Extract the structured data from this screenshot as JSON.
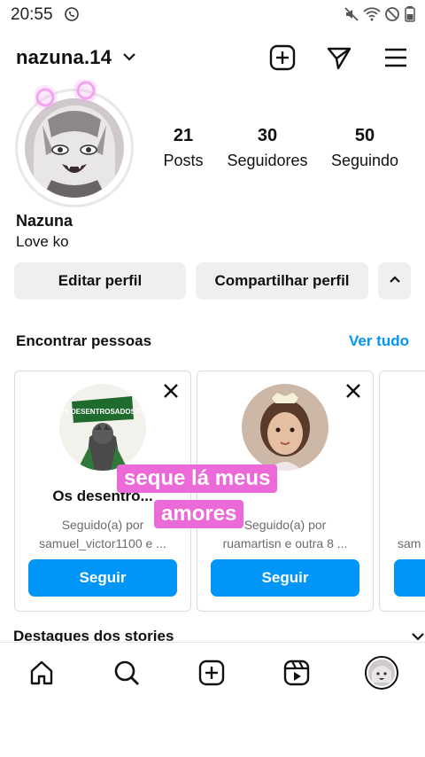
{
  "status_bar": {
    "time": "20:55",
    "icons": [
      "whatsapp-icon",
      "mute-icon",
      "wifi-icon",
      "dnd-icon",
      "battery-icon"
    ]
  },
  "header": {
    "username": "nazuna.14",
    "icons": [
      "chevron-down-icon",
      "add-post-icon",
      "send-icon",
      "menu-icon"
    ]
  },
  "profile": {
    "stats": [
      {
        "value": "21",
        "label": "Posts"
      },
      {
        "value": "30",
        "label": "Seguidores"
      },
      {
        "value": "50",
        "label": "Seguindo"
      }
    ],
    "name": "Nazuna",
    "bio": "Love ko"
  },
  "actions": {
    "edit_label": "Editar perfil",
    "share_label": "Compartilhar perfil"
  },
  "suggestions": {
    "title": "Encontrar pessoas",
    "see_all": "Ver tudo",
    "cards": [
      {
        "name": "Os desentro...",
        "line1": "Seguido(a) por",
        "line2": "samuel_victor1100 e ...",
        "follow": "Seguir",
        "pic_text": "OS DESENTROSADOS FC"
      },
      {
        "name": "",
        "line1": "Seguido(a) por",
        "line2": "ruamartisn e outra 8 ...",
        "follow": "Seguir"
      },
      {
        "line2": "sam",
        "follow": ""
      }
    ]
  },
  "overlay": {
    "line1": "seque lá meus",
    "line2": "amores"
  },
  "stories": {
    "title": "Destaques dos stories"
  },
  "nav": {
    "icons": [
      "home-icon",
      "search-icon",
      "create-icon",
      "reels-icon",
      "profile-avatar"
    ]
  },
  "colors": {
    "accent": "#0095f6",
    "button_gray": "#efefef",
    "overlay_pink": "#ec6ad8"
  }
}
